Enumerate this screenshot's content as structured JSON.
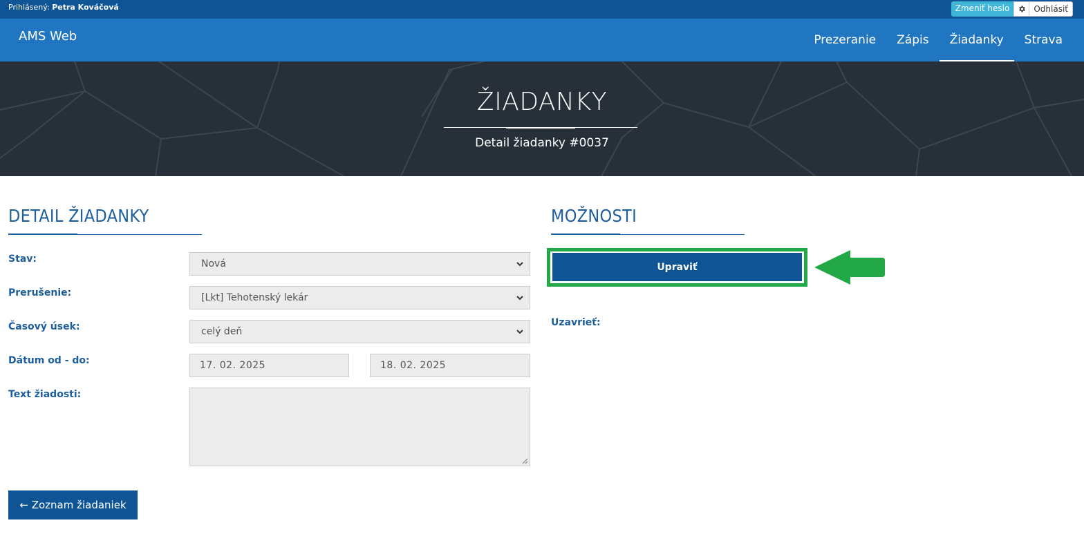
{
  "userbar": {
    "prefix": "Prihlásený:",
    "user": "Petra Kováčová",
    "change_password": "Zmeniť heslo",
    "settings_icon": "gear-icon",
    "logout": "Odhlásiť"
  },
  "brand": "AMS Web",
  "nav": {
    "items": [
      "Prezeranie",
      "Zápis",
      "Žiadanky",
      "Strava"
    ],
    "active": "Žiadanky"
  },
  "hero": {
    "title": "ŽIADANKY",
    "subtitle": "Detail žiadanky #0037"
  },
  "detail": {
    "title": "DETAIL ŽIADANKY",
    "fields": {
      "status_label": "Stav:",
      "status_value": "Nová",
      "interruption_label": "Prerušenie:",
      "interruption_value": "[Lkt] Tehotenský lekár",
      "time_label": "Časový úsek:",
      "time_value": "celý deň",
      "date_label": "Dátum od - do:",
      "date_from": "17. 02. 2025",
      "date_to": "18. 02. 2025",
      "text_label": "Text žiadosti:",
      "text_value": ""
    },
    "back_button": "← Zoznam žiadaniek"
  },
  "options": {
    "title": "MOŽNOSTI",
    "edit_button": "Upraviť",
    "close_label": "Uzavrieť:"
  },
  "colors": {
    "userbar": "#0f5596",
    "navbar": "#2076c0",
    "accent": "#1d5f9e",
    "button": "#0f5596",
    "highlight": "#22a846"
  }
}
